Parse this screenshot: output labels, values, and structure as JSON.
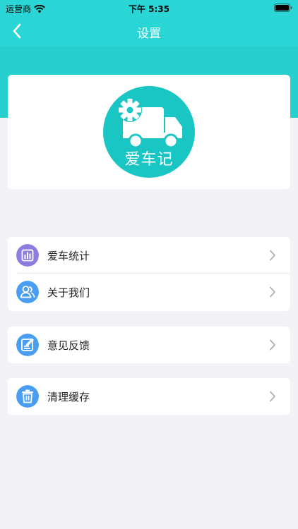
{
  "status_bar": {
    "carrier": "运营商",
    "time": "下午 5:35"
  },
  "nav": {
    "title": "设置"
  },
  "logo": {
    "text": "爱车记"
  },
  "menu": {
    "stats_label": "爱车统计",
    "about_label": "关于我们",
    "feedback_label": "意见反馈",
    "cache_label": "清理缓存"
  },
  "colors": {
    "header": "#27d0cf",
    "logo": "#19c6c4",
    "stats_icon": "#8c7ee0",
    "blue_icon": "#4a9ef2"
  }
}
